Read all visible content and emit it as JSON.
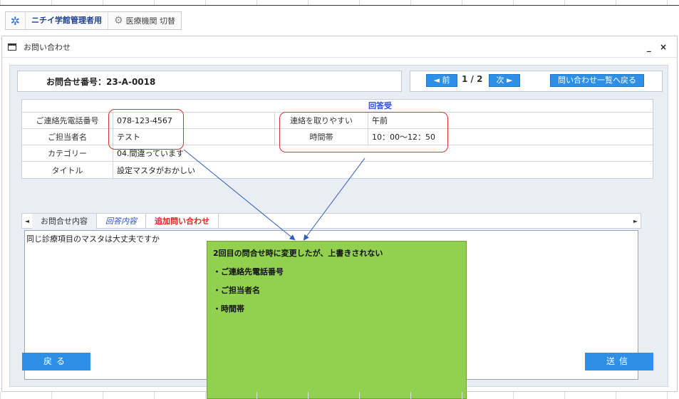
{
  "header": {
    "org_name": "ニチイ学館管理者用",
    "switch_label": "医療機関 切替"
  },
  "window": {
    "title": "お問い合わせ",
    "controls": "_ ×"
  },
  "inquiry": {
    "id_label": "お問合せ番号：23-A-0018",
    "prev_label": "◄ 前",
    "pager": "1 / 2",
    "next_label": "次 ►",
    "back_to_list_label": "問い合わせ一覧へ戻る"
  },
  "form": {
    "header": "回答受",
    "phone_label": "ご連絡先電話番号",
    "phone_value": "078-123-4567",
    "reach_label": "連絡を取りやすい",
    "reach_value": "午前",
    "person_label": "ご担当者名",
    "person_value": "テスト",
    "time_label": "時間帯",
    "time_value": "10：00〜12：50",
    "category_label": "カテゴリー",
    "category_value": "04.間違っています",
    "title_label": "タイトル",
    "title_value": "設定マスタがおかしい"
  },
  "tabs": {
    "t1": "お問合せ内容",
    "t2": "回答内容",
    "t3": "追加問い合わせ"
  },
  "content_text": "同じ診療項目のマスタは大丈夫ですか",
  "buttons": {
    "back": "戻る",
    "send": "送信"
  },
  "note": {
    "line1": "2回目の問合せ時に変更したが、上書きされない",
    "line2": "・ご連絡先電話番号",
    "line3": "・ご担当者名",
    "line4": "・時間帯"
  },
  "colors": {
    "accent_blue": "#2d8fe6",
    "note_green": "#92d050",
    "callout_red": "#e03131"
  }
}
